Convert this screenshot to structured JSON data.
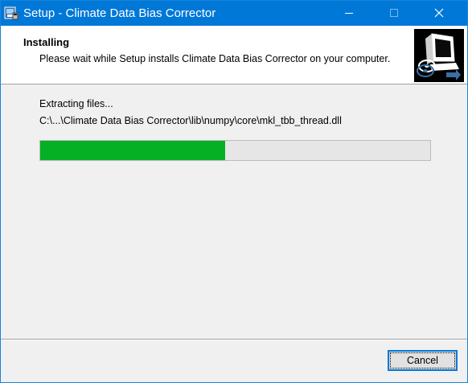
{
  "window": {
    "title": "Setup - Climate Data Bias Corrector",
    "icon": "setup-installer-icon",
    "controls": {
      "minimize_icon": "minimize-icon",
      "maximize_icon": "maximize-icon",
      "close_icon": "close-icon"
    }
  },
  "header": {
    "title": "Installing",
    "subtitle": "Please wait while Setup installs Climate Data Bias Corrector on your computer.",
    "image": "computer-install-image"
  },
  "main": {
    "status": "Extracting files...",
    "filename": "C:\\...\\Climate Data Bias Corrector\\lib\\numpy\\core\\mkl_tbb_thread.dll",
    "progress_fraction": 0.475
  },
  "footer": {
    "cancel_label": "Cancel"
  },
  "colors": {
    "titlebar": "#0078d7",
    "progress_fill": "#06b025",
    "button_focus": "#0078d7"
  }
}
